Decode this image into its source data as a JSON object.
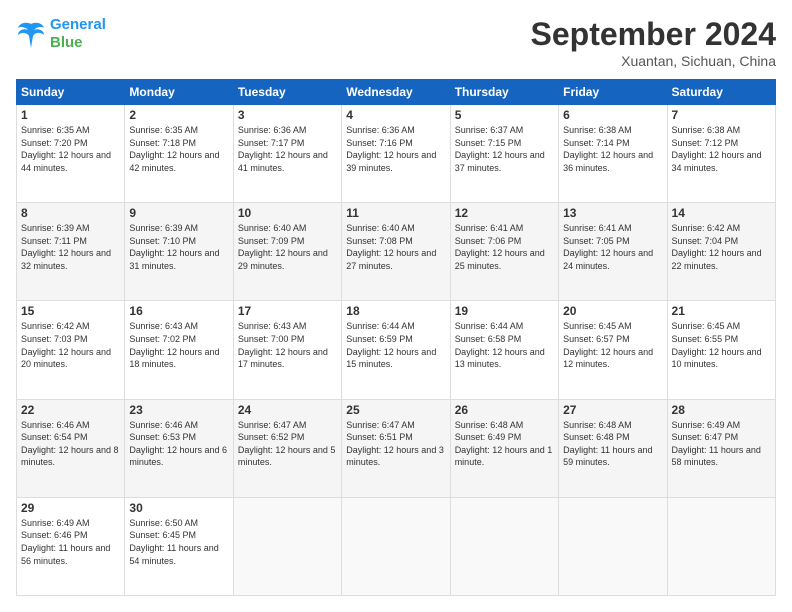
{
  "header": {
    "logo_line1": "General",
    "logo_line2": "Blue",
    "month": "September 2024",
    "location": "Xuantan, Sichuan, China"
  },
  "days_of_week": [
    "Sunday",
    "Monday",
    "Tuesday",
    "Wednesday",
    "Thursday",
    "Friday",
    "Saturday"
  ],
  "weeks": [
    [
      {
        "day": "1",
        "sunrise": "6:35 AM",
        "sunset": "7:20 PM",
        "daylight": "12 hours and 44 minutes."
      },
      {
        "day": "2",
        "sunrise": "6:35 AM",
        "sunset": "7:18 PM",
        "daylight": "12 hours and 42 minutes."
      },
      {
        "day": "3",
        "sunrise": "6:36 AM",
        "sunset": "7:17 PM",
        "daylight": "12 hours and 41 minutes."
      },
      {
        "day": "4",
        "sunrise": "6:36 AM",
        "sunset": "7:16 PM",
        "daylight": "12 hours and 39 minutes."
      },
      {
        "day": "5",
        "sunrise": "6:37 AM",
        "sunset": "7:15 PM",
        "daylight": "12 hours and 37 minutes."
      },
      {
        "day": "6",
        "sunrise": "6:38 AM",
        "sunset": "7:14 PM",
        "daylight": "12 hours and 36 minutes."
      },
      {
        "day": "7",
        "sunrise": "6:38 AM",
        "sunset": "7:12 PM",
        "daylight": "12 hours and 34 minutes."
      }
    ],
    [
      {
        "day": "8",
        "sunrise": "6:39 AM",
        "sunset": "7:11 PM",
        "daylight": "12 hours and 32 minutes."
      },
      {
        "day": "9",
        "sunrise": "6:39 AM",
        "sunset": "7:10 PM",
        "daylight": "12 hours and 31 minutes."
      },
      {
        "day": "10",
        "sunrise": "6:40 AM",
        "sunset": "7:09 PM",
        "daylight": "12 hours and 29 minutes."
      },
      {
        "day": "11",
        "sunrise": "6:40 AM",
        "sunset": "7:08 PM",
        "daylight": "12 hours and 27 minutes."
      },
      {
        "day": "12",
        "sunrise": "6:41 AM",
        "sunset": "7:06 PM",
        "daylight": "12 hours and 25 minutes."
      },
      {
        "day": "13",
        "sunrise": "6:41 AM",
        "sunset": "7:05 PM",
        "daylight": "12 hours and 24 minutes."
      },
      {
        "day": "14",
        "sunrise": "6:42 AM",
        "sunset": "7:04 PM",
        "daylight": "12 hours and 22 minutes."
      }
    ],
    [
      {
        "day": "15",
        "sunrise": "6:42 AM",
        "sunset": "7:03 PM",
        "daylight": "12 hours and 20 minutes."
      },
      {
        "day": "16",
        "sunrise": "6:43 AM",
        "sunset": "7:02 PM",
        "daylight": "12 hours and 18 minutes."
      },
      {
        "day": "17",
        "sunrise": "6:43 AM",
        "sunset": "7:00 PM",
        "daylight": "12 hours and 17 minutes."
      },
      {
        "day": "18",
        "sunrise": "6:44 AM",
        "sunset": "6:59 PM",
        "daylight": "12 hours and 15 minutes."
      },
      {
        "day": "19",
        "sunrise": "6:44 AM",
        "sunset": "6:58 PM",
        "daylight": "12 hours and 13 minutes."
      },
      {
        "day": "20",
        "sunrise": "6:45 AM",
        "sunset": "6:57 PM",
        "daylight": "12 hours and 12 minutes."
      },
      {
        "day": "21",
        "sunrise": "6:45 AM",
        "sunset": "6:55 PM",
        "daylight": "12 hours and 10 minutes."
      }
    ],
    [
      {
        "day": "22",
        "sunrise": "6:46 AM",
        "sunset": "6:54 PM",
        "daylight": "12 hours and 8 minutes."
      },
      {
        "day": "23",
        "sunrise": "6:46 AM",
        "sunset": "6:53 PM",
        "daylight": "12 hours and 6 minutes."
      },
      {
        "day": "24",
        "sunrise": "6:47 AM",
        "sunset": "6:52 PM",
        "daylight": "12 hours and 5 minutes."
      },
      {
        "day": "25",
        "sunrise": "6:47 AM",
        "sunset": "6:51 PM",
        "daylight": "12 hours and 3 minutes."
      },
      {
        "day": "26",
        "sunrise": "6:48 AM",
        "sunset": "6:49 PM",
        "daylight": "12 hours and 1 minute."
      },
      {
        "day": "27",
        "sunrise": "6:48 AM",
        "sunset": "6:48 PM",
        "daylight": "11 hours and 59 minutes."
      },
      {
        "day": "28",
        "sunrise": "6:49 AM",
        "sunset": "6:47 PM",
        "daylight": "11 hours and 58 minutes."
      }
    ],
    [
      {
        "day": "29",
        "sunrise": "6:49 AM",
        "sunset": "6:46 PM",
        "daylight": "11 hours and 56 minutes."
      },
      {
        "day": "30",
        "sunrise": "6:50 AM",
        "sunset": "6:45 PM",
        "daylight": "11 hours and 54 minutes."
      },
      null,
      null,
      null,
      null,
      null
    ]
  ]
}
